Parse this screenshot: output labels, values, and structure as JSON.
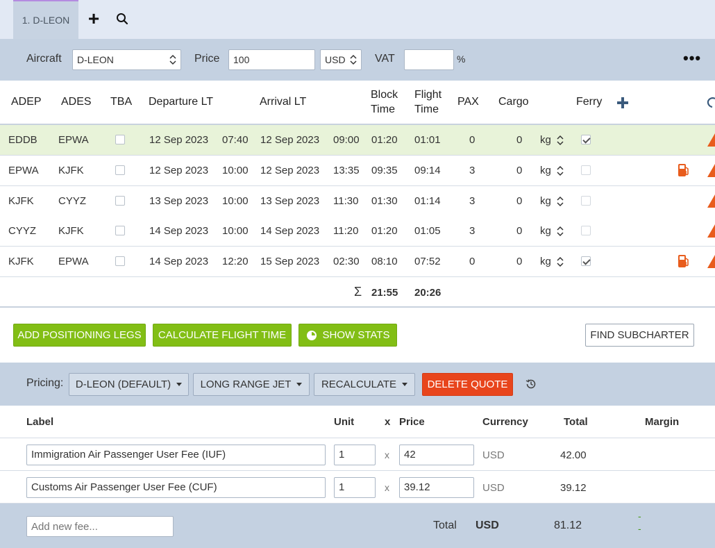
{
  "tabs": [
    {
      "label": "1. D-LEON"
    }
  ],
  "toolbar": {
    "aircraft_label": "Aircraft",
    "aircraft_value": "D-LEON",
    "price_label": "Price",
    "price_value": "100",
    "currency_value": "USD",
    "vat_label": "VAT",
    "vat_value": "",
    "vat_unit": "%"
  },
  "legs_table": {
    "headers": {
      "adep": "ADEP",
      "ades": "ADES",
      "tba": "TBA",
      "departure": "Departure LT",
      "arrival": "Arrival LT",
      "block_time_1": "Block",
      "block_time_2": "Time",
      "flight_time_1": "Flight",
      "flight_time_2": "Time",
      "pax": "PAX",
      "cargo": "Cargo",
      "ferry": "Ferry"
    },
    "rows": [
      {
        "adep": "EDDB",
        "ades": "EPWA",
        "tba": false,
        "dep_date": "12 Sep 2023",
        "dep_time": "07:40",
        "arr_date": "12 Sep 2023",
        "arr_time": "09:00",
        "block": "01:20",
        "flight": "01:01",
        "pax": "0",
        "cargo": "0",
        "cargo_unit": "kg",
        "ferry": true,
        "fuel_icon": false,
        "highlighted": true
      },
      {
        "adep": "EPWA",
        "ades": "KJFK",
        "tba": false,
        "dep_date": "12 Sep 2023",
        "dep_time": "10:00",
        "arr_date": "12 Sep 2023",
        "arr_time": "13:35",
        "block": "09:35",
        "flight": "09:14",
        "pax": "3",
        "cargo": "0",
        "cargo_unit": "kg",
        "ferry": false,
        "fuel_icon": true,
        "highlighted": false
      },
      {
        "adep": "KJFK",
        "ades": "CYYZ",
        "tba": false,
        "dep_date": "13 Sep 2023",
        "dep_time": "10:00",
        "arr_date": "13 Sep 2023",
        "arr_time": "11:30",
        "block": "01:30",
        "flight": "01:14",
        "pax": "3",
        "cargo": "0",
        "cargo_unit": "kg",
        "ferry": false,
        "fuel_icon": false,
        "highlighted": false
      },
      {
        "adep": "CYYZ",
        "ades": "KJFK",
        "tba": false,
        "dep_date": "14 Sep 2023",
        "dep_time": "10:00",
        "arr_date": "14 Sep 2023",
        "arr_time": "11:20",
        "block": "01:20",
        "flight": "01:05",
        "pax": "3",
        "cargo": "0",
        "cargo_unit": "kg",
        "ferry": false,
        "fuel_icon": false,
        "highlighted": false
      },
      {
        "adep": "KJFK",
        "ades": "EPWA",
        "tba": false,
        "dep_date": "14 Sep 2023",
        "dep_time": "12:20",
        "arr_date": "15 Sep 2023",
        "arr_time": "02:30",
        "block": "08:10",
        "flight": "07:52",
        "pax": "0",
        "cargo": "0",
        "cargo_unit": "kg",
        "ferry": true,
        "fuel_icon": true,
        "highlighted": false
      }
    ],
    "sum_symbol": "Σ",
    "sum_block": "21:55",
    "sum_flight": "20:26"
  },
  "actions": {
    "add_positioning": "ADD POSITIONING LEGS",
    "calculate_flight_time": "CALCULATE FLIGHT TIME",
    "show_stats": "SHOW STATS",
    "find_subcharter": "FIND SUBCHARTER"
  },
  "pricing": {
    "label": "Pricing:",
    "profile": "D-LEON (DEFAULT)",
    "category": "LONG RANGE JET",
    "recalculate": "RECALCULATE",
    "delete_quote": "DELETE QUOTE"
  },
  "fees_table": {
    "headers": {
      "label": "Label",
      "unit": "Unit",
      "x": "x",
      "price": "Price",
      "currency": "Currency",
      "total": "Total",
      "margin": "Margin"
    },
    "rows": [
      {
        "label": "Immigration Air Passenger User Fee (IUF)",
        "unit": "1",
        "x": "x",
        "price": "42",
        "currency": "USD",
        "total": "42.00"
      },
      {
        "label": "Customs Air Passenger User Fee (CUF)",
        "unit": "1",
        "x": "x",
        "price": "39.12",
        "currency": "USD",
        "total": "39.12"
      }
    ]
  },
  "footer": {
    "new_fee_placeholder": "Add new fee...",
    "total_label": "Total",
    "total_currency": "USD",
    "total_value": "81.12",
    "margin_value_1": "-",
    "margin_value_2": "-"
  },
  "colors": {
    "accent_green": "#82be15",
    "delete_red": "#e8451c",
    "warning_orange": "#e85c1c",
    "row_highlight": "#e8f3d9",
    "toolbar_blue": "#c4d1e1"
  }
}
